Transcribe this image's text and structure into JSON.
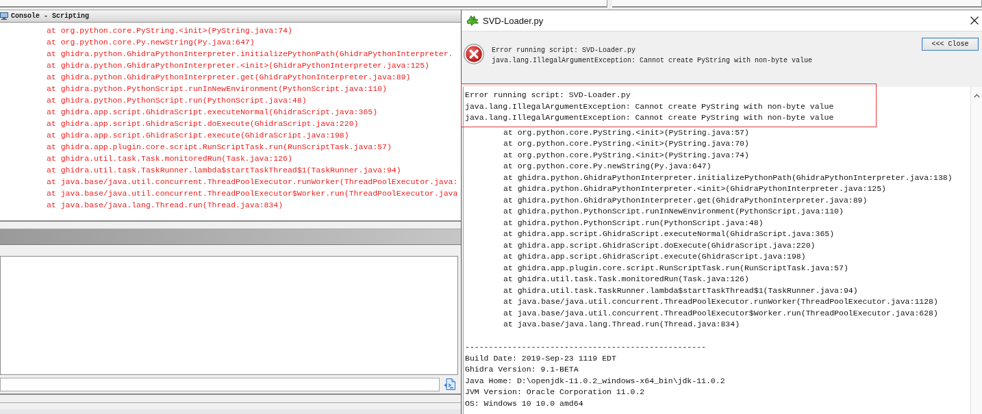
{
  "console": {
    "title": "Console - Scripting",
    "lines": [
      "at org.python.core.PyString.<init>(PyString.java:74)",
      "at org.python.core.Py.newString(Py.java:647)",
      "at ghidra.python.GhidraPythonInterpreter.initializePythonPath(GhidraPythonInterpreter.",
      "at ghidra.python.GhidraPythonInterpreter.<init>(GhidraPythonInterpreter.java:125)",
      "at ghidra.python.GhidraPythonInterpreter.get(GhidraPythonInterpreter.java:89)",
      "at ghidra.python.PythonScript.runInNewEnvironment(PythonScript.java:110)",
      "at ghidra.python.PythonScript.run(PythonScript.java:48)",
      "at ghidra.app.script.GhidraScript.executeNormal(GhidraScript.java:365)",
      "at ghidra.app.script.GhidraScript.doExecute(GhidraScript.java:220)",
      "at ghidra.app.script.GhidraScript.execute(GhidraScript.java:198)",
      "at ghidra.app.plugin.core.script.RunScriptTask.run(RunScriptTask.java:57)",
      "at ghidra.util.task.Task.monitoredRun(Task.java:126)",
      "at ghidra.util.task.TaskRunner.lambda$startTaskThread$1(TaskRunner.java:94)",
      "at java.base/java.util.concurrent.ThreadPoolExecutor.runWorker(ThreadPoolExecutor.java:",
      "at java.base/java.util.concurrent.ThreadPoolExecutor$Worker.run(ThreadPoolExecutor.java",
      "at java.base/java.lang.Thread.run(Thread.java:834)"
    ]
  },
  "dialog": {
    "title": "SVD-Loader.py",
    "messages": [
      "Error running script: SVD-Loader.py",
      "java.lang.IllegalArgumentException: Cannot create PyString with non-byte value"
    ],
    "close_button": {
      "label": "<<< Close",
      "focused": true
    },
    "output": [
      {
        "highlighted": true,
        "lines": [
          {
            "kind": "message",
            "text": "Error running script: SVD-Loader.py"
          },
          {
            "kind": "message",
            "text": "java.lang.IllegalArgumentException: Cannot create PyString with non-byte value"
          },
          {
            "kind": "message",
            "text": "java.lang.IllegalArgumentException: Cannot create PyString with non-byte value"
          }
        ]
      },
      {
        "highlighted": false,
        "lines": [
          {
            "kind": "frame",
            "text": "at org.python.core.PyString.<init>(PyString.java:57)"
          },
          {
            "kind": "frame",
            "text": "at org.python.core.PyString.<init>(PyString.java:70)"
          },
          {
            "kind": "frame",
            "text": "at org.python.core.PyString.<init>(PyString.java:74)"
          },
          {
            "kind": "frame",
            "text": "at org.python.core.Py.newString(Py.java:647)"
          },
          {
            "kind": "frame",
            "text": "at ghidra.python.GhidraPythonInterpreter.initializePythonPath(GhidraPythonInterpreter.java:138)"
          },
          {
            "kind": "frame",
            "text": "at ghidra.python.GhidraPythonInterpreter.<init>(GhidraPythonInterpreter.java:125)"
          },
          {
            "kind": "frame",
            "text": "at ghidra.python.GhidraPythonInterpreter.get(GhidraPythonInterpreter.java:89)"
          },
          {
            "kind": "frame",
            "text": "at ghidra.python.PythonScript.runInNewEnvironment(PythonScript.java:110)"
          },
          {
            "kind": "frame",
            "text": "at ghidra.python.PythonScript.run(PythonScript.java:48)"
          },
          {
            "kind": "frame",
            "text": "at ghidra.app.script.GhidraScript.executeNormal(GhidraScript.java:365)"
          },
          {
            "kind": "frame",
            "text": "at ghidra.app.script.GhidraScript.doExecute(GhidraScript.java:220)"
          },
          {
            "kind": "frame",
            "text": "at ghidra.app.script.GhidraScript.execute(GhidraScript.java:198)"
          },
          {
            "kind": "frame",
            "text": "at ghidra.app.plugin.core.script.RunScriptTask.run(RunScriptTask.java:57)"
          },
          {
            "kind": "frame",
            "text": "at ghidra.util.task.Task.monitoredRun(Task.java:126)"
          },
          {
            "kind": "frame",
            "text": "at ghidra.util.task.TaskRunner.lambda$startTaskThread$1(TaskRunner.java:94)"
          },
          {
            "kind": "frame",
            "text": "at java.base/java.util.concurrent.ThreadPoolExecutor.runWorker(ThreadPoolExecutor.java:1128)"
          },
          {
            "kind": "frame",
            "text": "at java.base/java.util.concurrent.ThreadPoolExecutor$Worker.run(ThreadPoolExecutor.java:628)"
          },
          {
            "kind": "frame",
            "text": "at java.base/java.lang.Thread.run(Thread.java:834)"
          },
          {
            "kind": "blank"
          },
          {
            "kind": "message",
            "text": "---------------------------------------------------"
          },
          {
            "kind": "message",
            "text": "Build Date: 2019-Sep-23 1119 EDT"
          },
          {
            "kind": "message",
            "text": "Ghidra Version: 9.1-BETA"
          },
          {
            "kind": "message",
            "text": "Java Home: D:\\openjdk-11.0.2_windows-x64_bin\\jdk-11.0.2"
          },
          {
            "kind": "message",
            "text": "JVM Version: Oracle Corporation 11.0.2"
          },
          {
            "kind": "message",
            "text": "OS: Windows 10 10.0 amd64"
          }
        ]
      }
    ]
  }
}
